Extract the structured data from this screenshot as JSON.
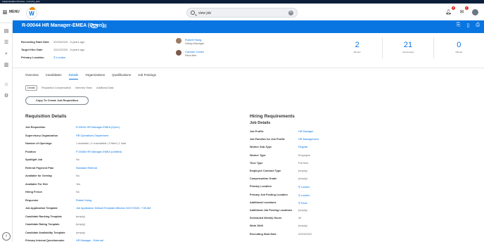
{
  "env_bar": "Implementation Preview - cmcvchy_dpt1",
  "topbar": {
    "menu_label": "MENU",
    "logo_letter": "W",
    "search_value": "view job",
    "notifications_count": "6",
    "inbox_count": "1"
  },
  "header": {
    "title": "R-00044 HR Manager-EMEA (Open)"
  },
  "summary": {
    "fields": [
      {
        "label": "Recruiting Start Date",
        "value": "02/03/2020 - 5 years ago"
      },
      {
        "label": "Target Hire Date",
        "value": "10/12/2020 - 5 years ago"
      },
      {
        "label": "Primary Location",
        "value": "London"
      }
    ],
    "people": [
      {
        "name": "Robert Hsing",
        "role": "Hiring Manager"
      },
      {
        "name": "Carmen Cortez",
        "role": "Recruiter"
      }
    ],
    "stats": [
      {
        "number": "2",
        "label": "Review"
      },
      {
        "number": "21",
        "label": "Interviewing"
      },
      {
        "number": "0",
        "label": "Offered"
      }
    ]
  },
  "tabs": [
    "Overview",
    "Candidates",
    "Details",
    "Organizations",
    "Qualifications",
    "Job Postings"
  ],
  "subtabs": [
    "Details",
    "Requisition Compensation",
    "Interview Team",
    "Additional Data"
  ],
  "copy_button": "Copy To Create Job Requisition",
  "requisition": {
    "title": "Requisition Details",
    "rows": [
      {
        "label": "Job Requisition",
        "value": "R-00044 HR Manager-EMEA (Open)"
      },
      {
        "label": "Supervisory Organization",
        "value": "HR Operations Department"
      },
      {
        "label": "Number of Openings",
        "value": "1 available | 0 unavailable | 0 filled | 1 total"
      },
      {
        "label": "Position",
        "value": "P-00456 HR Manager-EMEA (Unfilled)"
      },
      {
        "label": "Spotlight Job",
        "value": "No"
      },
      {
        "label": "Referral Payment Plan",
        "value": "Standard Referral"
      },
      {
        "label": "Available for Overlap",
        "value": "No"
      },
      {
        "label": "Available For Hire",
        "value": "Yes"
      },
      {
        "label": "Hiring Freeze",
        "value": "No"
      },
      {
        "label": "Requester",
        "value": "Robert Hsing"
      },
      {
        "label": "Job Application Template",
        "value": "Job Application Default Template effective 02/07/2020, 7:35 AM"
      },
      {
        "label": "Candidate Ranking Template",
        "value": "(empty)"
      },
      {
        "label": "Candidate Rating Template",
        "value": "(empty)"
      },
      {
        "label": "Candidate Availability Template",
        "value": "(empty)"
      },
      {
        "label": "Primary Internal Questionnaire",
        "value": "HR Manager - External"
      }
    ]
  },
  "hiring": {
    "title": "Hiring Requirements",
    "subtitle": "Job Details",
    "rows": [
      {
        "label": "Job Profile",
        "value": "HR Manager"
      },
      {
        "label": "Job Families for Job Profile",
        "value": "HR-Management"
      },
      {
        "label": "Worker Sub-Type",
        "value": "Regular"
      },
      {
        "label": "Worker Type",
        "value": "Employee"
      },
      {
        "label": "Time Type",
        "value": "Full time"
      },
      {
        "label": "Employee Contract Type",
        "value": "(empty)"
      },
      {
        "label": "Compensation Grade",
        "value": "(empty)"
      },
      {
        "label": "Primary Location",
        "value": "London"
      },
      {
        "label": "Primary Job Posting Location",
        "value": "London"
      },
      {
        "label": "Additional Locations",
        "value": "Paris"
      },
      {
        "label": "Additional Job Posting Locations",
        "value": "(empty)"
      },
      {
        "label": "Scheduled Weekly Hours",
        "value": "40"
      },
      {
        "label": "Work Shift",
        "value": "(empty)"
      },
      {
        "label": "Recruiting Start Date",
        "value": "02/03/2020"
      }
    ]
  }
}
